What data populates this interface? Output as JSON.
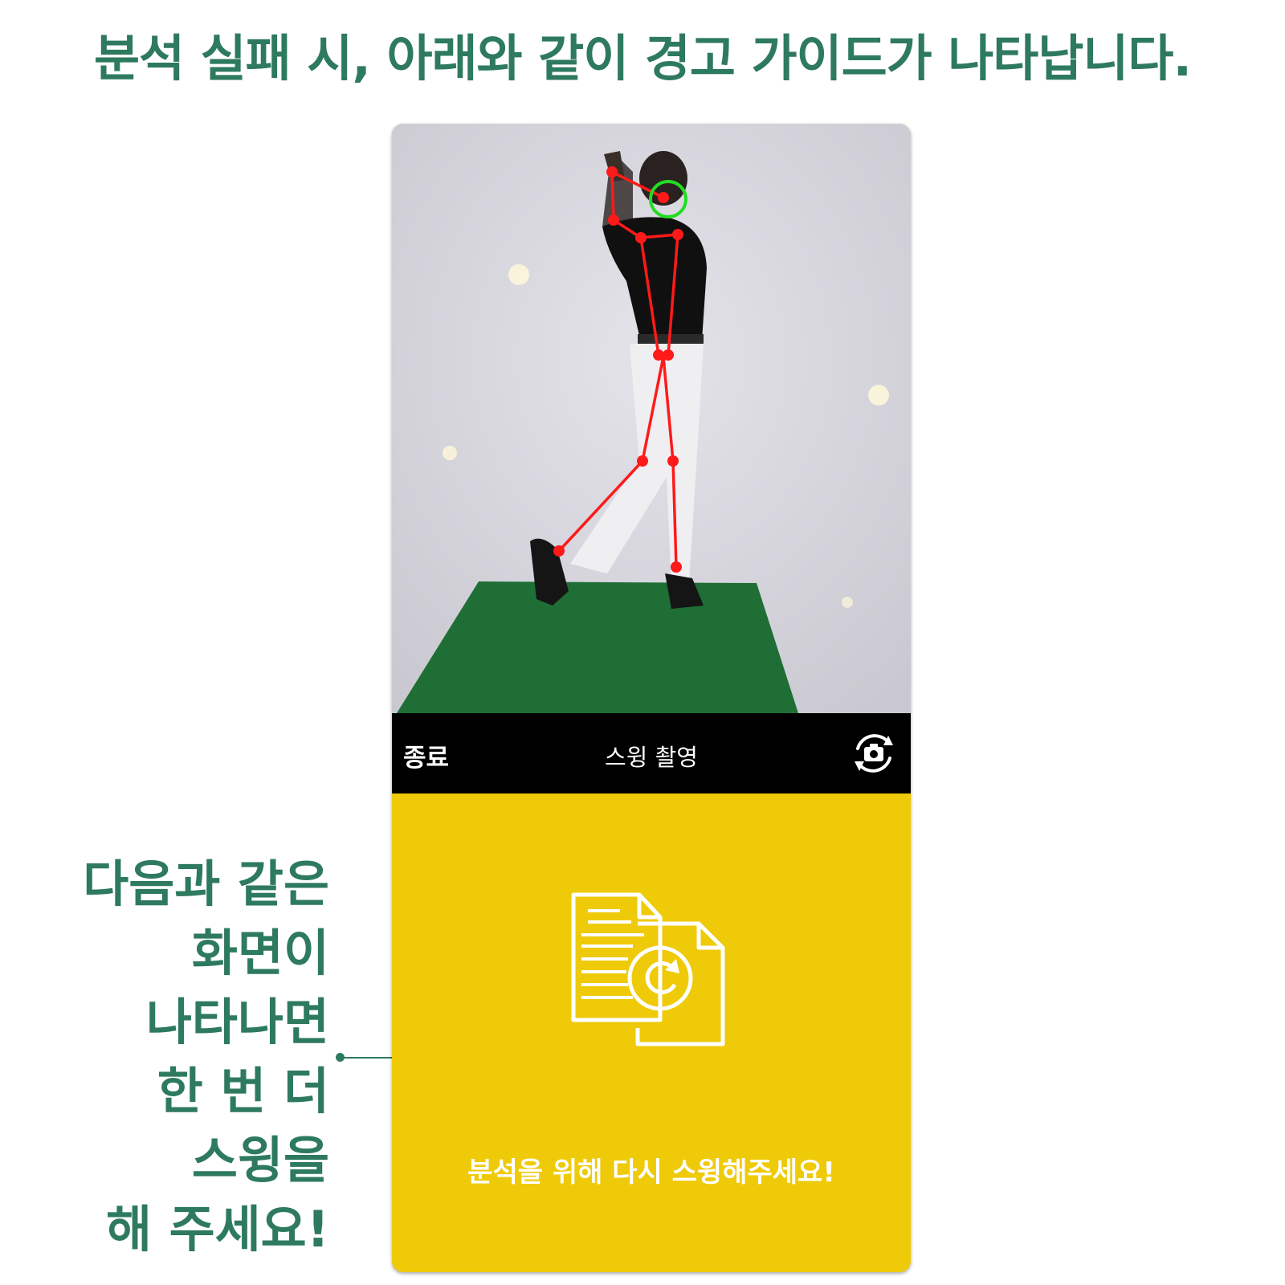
{
  "headline": "분석 실패 시, 아래와 같이 경고 가이드가 나타납니다.",
  "side_note": {
    "lines": [
      "다음과 같은",
      "화면이",
      "나타나면",
      "한 번 더",
      "스윙을",
      "해 주세요!"
    ]
  },
  "app": {
    "exit_label": "종료",
    "title": "스윙 촬영",
    "flip_icon": "camera-switch-icon",
    "warning_icon": "document-refresh-icon",
    "warning_message": "분석을 위해 다시 스윙해주세요!"
  },
  "colors": {
    "accent_green": "#2e7a5e",
    "warning_yellow": "#efca09",
    "skeleton_red": "#ff1a1a",
    "head_marker_green": "#22dd22",
    "mat_green": "#1f6e35"
  }
}
